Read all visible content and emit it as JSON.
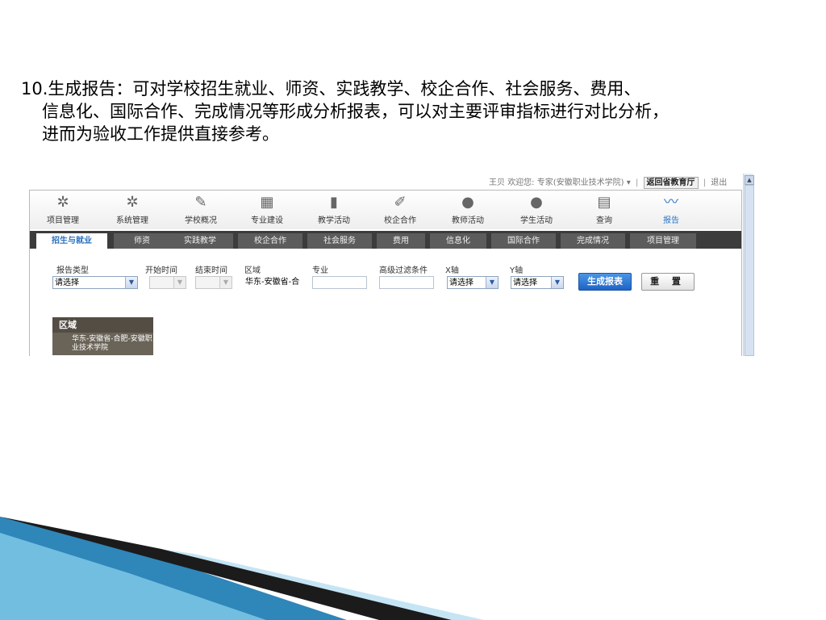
{
  "slide": {
    "line1": "10.生成报告：可对学校招生就业、师资、实践教学、校企合作、社会服务、费用、",
    "line2": "信息化、国际合作、完成情况等形成分析报表，可以对主要评审指标进行对比分析，",
    "line3": "进而为验收工作提供直接参考。"
  },
  "topbar": {
    "user": "王贝",
    "welcome": "欢迎您: 专家(安徽职业技术学院)",
    "back": "返回省教育厅",
    "logout": "退出"
  },
  "nav": [
    {
      "label": "项目管理",
      "icon": "gear-icon",
      "glyph": "✲"
    },
    {
      "label": "系统管理",
      "icon": "gear-icon",
      "glyph": "✲"
    },
    {
      "label": "学校概况",
      "icon": "pencil-icon",
      "glyph": "✎"
    },
    {
      "label": "专业建设",
      "icon": "building-icon",
      "glyph": "▦"
    },
    {
      "label": "教学活动",
      "icon": "book-icon",
      "glyph": "▮"
    },
    {
      "label": "校企合作",
      "icon": "edit-doc-icon",
      "glyph": "✐"
    },
    {
      "label": "教师活动",
      "icon": "person-icon",
      "glyph": "●"
    },
    {
      "label": "学生活动",
      "icon": "person-icon",
      "glyph": "●"
    },
    {
      "label": "查询",
      "icon": "document-icon",
      "glyph": "▤"
    },
    {
      "label": "报告",
      "icon": "chart-line-icon",
      "glyph": "〰"
    }
  ],
  "tabs": [
    "招生与就业",
    "师资",
    "实践教学",
    "校企合作",
    "社会服务",
    "费用",
    "信息化",
    "国际合作",
    "完成情况",
    "项目管理"
  ],
  "form": {
    "report_type_label": "报告类型",
    "report_type_value": "请选择",
    "start_label": "开始时间",
    "end_label": "结束时间",
    "region_label": "区域",
    "region_value": "华东-安徽省-合",
    "major_label": "专业",
    "filter_label": "高级过滤条件",
    "x_label": "X轴",
    "x_value": "请选择",
    "y_label": "Y轴",
    "y_value": "请选择",
    "generate": "生成报表",
    "reset": "重 置"
  },
  "region_box": {
    "header": "区域",
    "body": "华东-安徽省-合肥-安徽职业技术学院"
  },
  "colors": {
    "accent": "#2a78c8",
    "tabbar": "#3c3c3c",
    "generate": "#1e63c4"
  }
}
